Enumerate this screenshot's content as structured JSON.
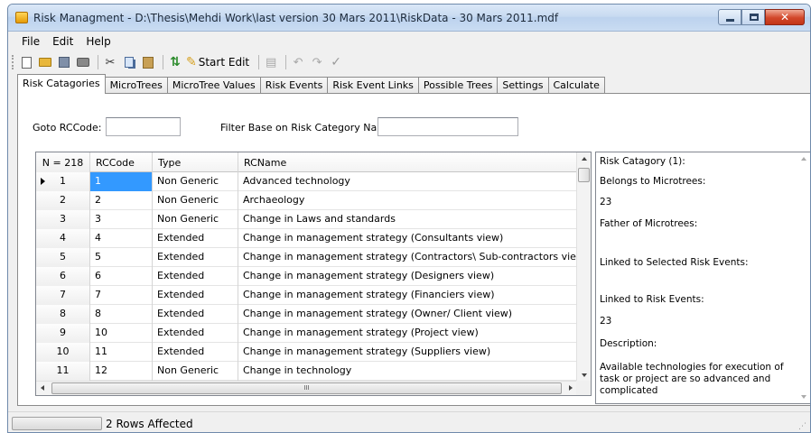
{
  "window": {
    "title": "Risk Managment - D:\\Thesis\\Mehdi Work\\last version 30 Mars 2011\\RiskData - 30 Mars 2011.mdf",
    "close_glyph": "✕"
  },
  "menu": [
    "File",
    "Edit",
    "Help"
  ],
  "toolbar": {
    "start_edit_label": "Start Edit",
    "icons": [
      "new-icon",
      "open-icon",
      "save-icon",
      "print-icon",
      "cut-icon",
      "copy-icon",
      "paste-icon",
      "refresh-icon",
      "pencil-icon",
      "grid-icon",
      "undo-icon",
      "redo-icon",
      "check-icon"
    ]
  },
  "tabs": [
    "Risk Catagories",
    "MicroTrees",
    "MicroTree Values",
    "Risk Events",
    "Risk Event Links",
    "Possible Trees",
    "Settings",
    "Calculate"
  ],
  "filters": {
    "goto_label": "Goto RCCode:",
    "goto_value": "",
    "filter_label": "Filter Base on Risk Category Name:",
    "filter_value": ""
  },
  "grid": {
    "headers": [
      "N = 218",
      "RCCode",
      "Type",
      "RCName"
    ],
    "rows": [
      {
        "n": "1",
        "code": "1",
        "type": "Non Generic",
        "name": "Advanced technology"
      },
      {
        "n": "2",
        "code": "2",
        "type": "Non Generic",
        "name": "Archaeology"
      },
      {
        "n": "3",
        "code": "3",
        "type": "Non Generic",
        "name": "Change in Laws and standards"
      },
      {
        "n": "4",
        "code": "4",
        "type": "Extended",
        "name": "Change in management strategy (Consultants view)"
      },
      {
        "n": "5",
        "code": "5",
        "type": "Extended",
        "name": "Change in management strategy (Contractors\\ Sub-contractors view)"
      },
      {
        "n": "6",
        "code": "6",
        "type": "Extended",
        "name": "Change in management strategy (Designers view)"
      },
      {
        "n": "7",
        "code": "7",
        "type": "Extended",
        "name": "Change in management strategy (Financiers view)"
      },
      {
        "n": "8",
        "code": "8",
        "type": "Extended",
        "name": "Change in management strategy (Owner/ Client view)"
      },
      {
        "n": "9",
        "code": "10",
        "type": "Extended",
        "name": "Change in management strategy (Project view)"
      },
      {
        "n": "10",
        "code": "11",
        "type": "Extended",
        "name": "Change in management strategy (Suppliers view)"
      },
      {
        "n": "11",
        "code": "12",
        "type": "Non Generic",
        "name": "Change in technology"
      }
    ],
    "hscroll_grip": "III"
  },
  "info": {
    "category": "Risk Catagory (1):",
    "belongs_label": "Belongs to Microtrees:",
    "belongs_value": "23",
    "father_label": "Father of Microtrees:",
    "linked_selected_label": "Linked to Selected Risk Events:",
    "linked_label": "Linked to Risk Events:",
    "linked_value": "23",
    "description_label": "Description:",
    "description_value": "Available technologies for execution of task or project are so advanced and complicated"
  },
  "status": {
    "text": "2 Rows Affected",
    "progress": 0,
    "grip": "⋰"
  }
}
